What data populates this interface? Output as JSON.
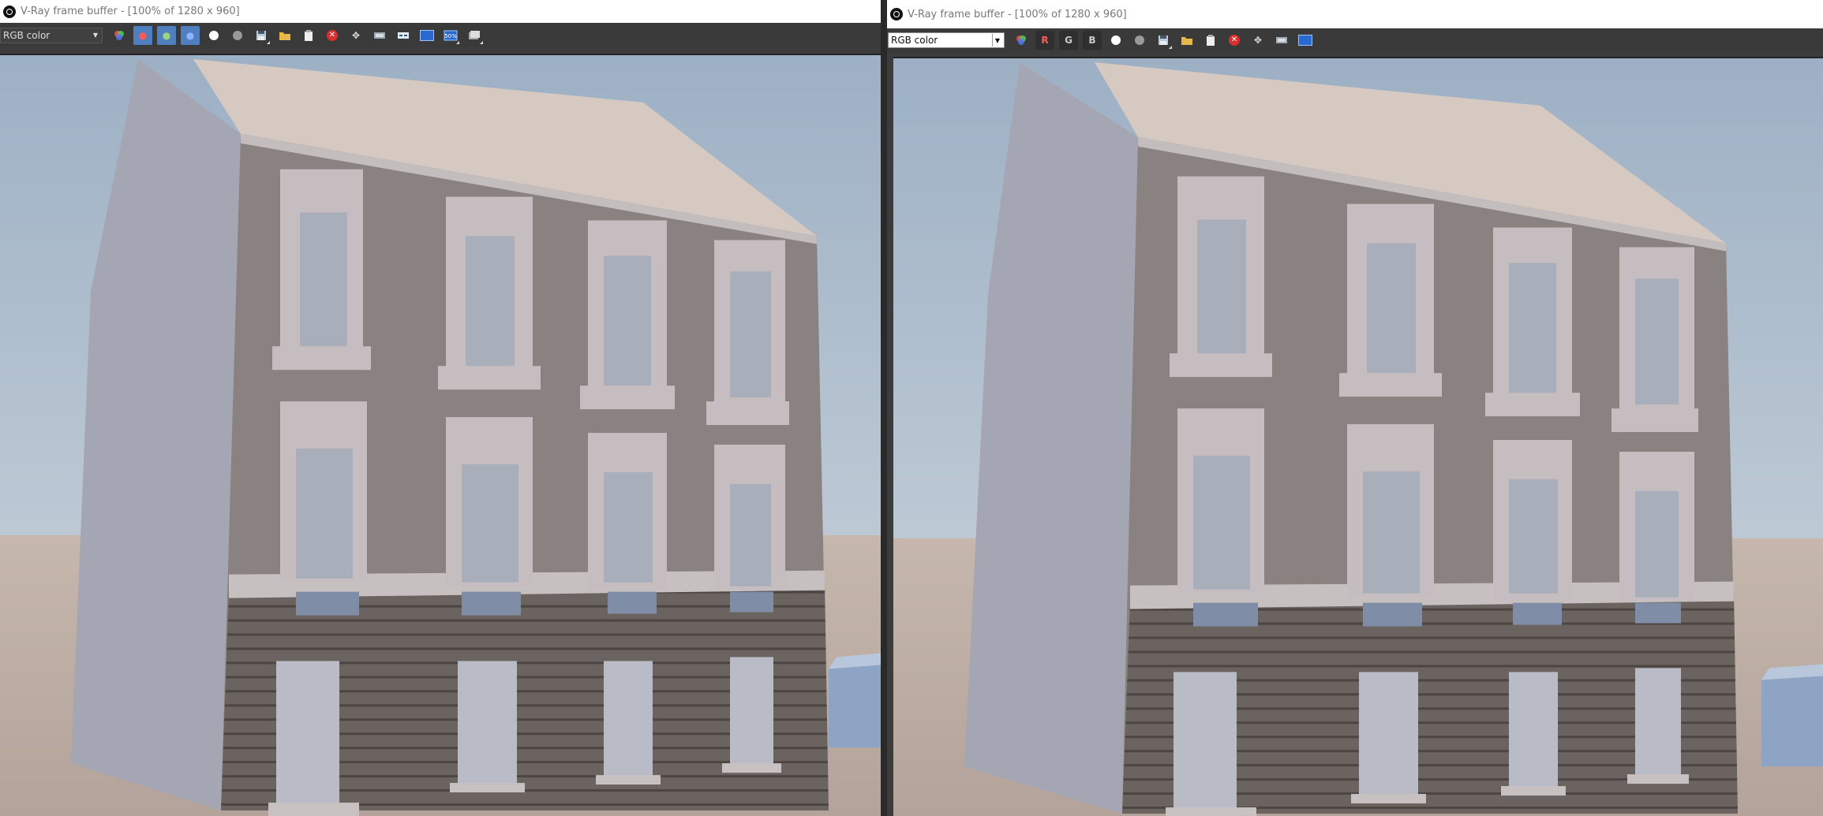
{
  "windows": [
    {
      "title": "V-Ray frame buffer - [100% of 1280 x 960]",
      "channel": "RGB color",
      "toolbar": [
        "color-correction-icon",
        "red-channel-icon",
        "green-channel-icon",
        "blue-channel-icon",
        "mono-view-icon",
        "alpha-view-icon",
        "save-icon",
        "load-icon",
        "clear-icon",
        "stop-render-icon",
        "track-mouse-icon",
        "lens-effects-icon",
        "color-correction-icon",
        "zoom-50-icon",
        "history-icon"
      ]
    },
    {
      "title": "V-Ray frame buffer - [100% of 1280 x 960]",
      "channel": "RGB color",
      "channel_letters": [
        "R",
        "G",
        "B"
      ],
      "toolbar": [
        "color-correction-icon",
        "red-channel-icon",
        "green-channel-icon",
        "blue-channel-icon",
        "mono-view-icon",
        "alpha-view-icon",
        "save-icon",
        "load-icon",
        "clear-icon",
        "stop-render-icon",
        "track-mouse-icon",
        "lens-effects-icon",
        "color-correction-icon"
      ]
    }
  ],
  "colors": {
    "sky": "#b7c6d3",
    "ground": "#c8b8ad",
    "wall_upper": "#8b8280",
    "wall_lower": "#6a625f",
    "trim": "#c9c2c3",
    "side_wall": "#a8a9b6",
    "roof": "#d8cbc4"
  }
}
